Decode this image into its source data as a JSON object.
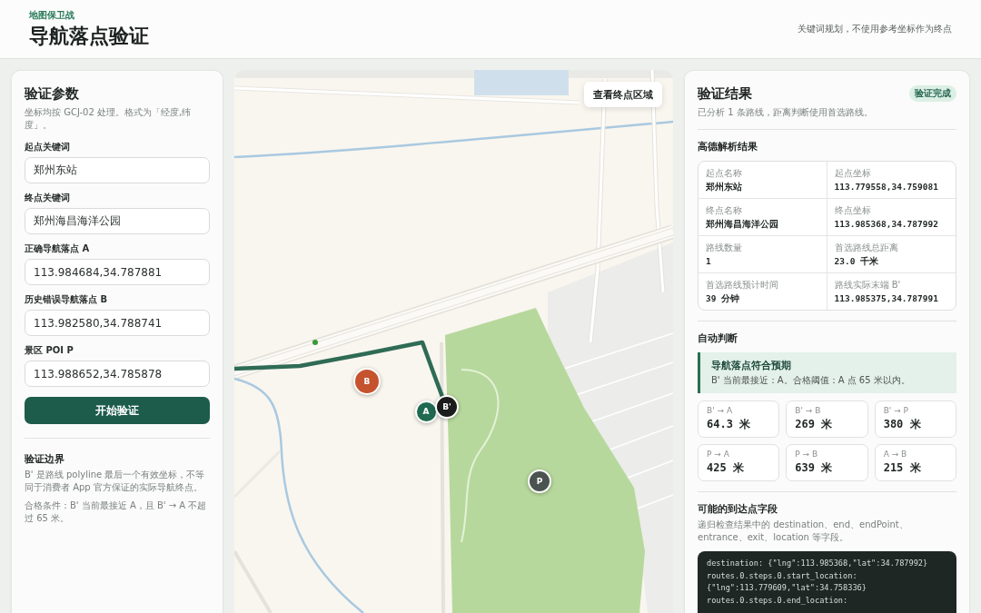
{
  "header": {
    "eyebrow": "地图保卫战",
    "title": "导航落点验证",
    "note": "关键词规划，不使用参考坐标作为终点"
  },
  "params": {
    "title": "验证参数",
    "hint": "坐标均按 GCJ-02 处理。格式为「经度,纬度」。",
    "fields": [
      {
        "label": "起点关键词",
        "value": "郑州东站"
      },
      {
        "label": "终点关键词",
        "value": "郑州海昌海洋公园"
      },
      {
        "label": "正确导航落点 A",
        "value": "113.984684,34.787881"
      },
      {
        "label": "历史错误导航落点 B",
        "value": "113.982580,34.788741"
      },
      {
        "label": "景区 POI P",
        "value": "113.988652,34.785878"
      }
    ],
    "submit": "开始验证",
    "boundary_title": "验证边界",
    "boundary_notes": [
      "B' 是路线 polyline 最后一个有效坐标，不等同于消费者 App 官方保证的实际导航终点。",
      "合格条件：B' 当前最接近 A，且 B' → A 不超过 65 米。"
    ]
  },
  "map": {
    "button": "查看终点区域",
    "markers": [
      {
        "label": "B",
        "color": "#c4532e"
      },
      {
        "label": "A",
        "color": "#1f6a50"
      },
      {
        "label": "B'",
        "color": "#1b1d1c"
      },
      {
        "label": "P",
        "color": "#4b5350"
      }
    ]
  },
  "results": {
    "title": "验证结果",
    "badge": "验证完成",
    "summary": "已分析 1 条路线，距离判断使用首选路线。",
    "parsed_title": "高德解析结果",
    "parsed": [
      {
        "label": "起点名称",
        "value": "郑州东站"
      },
      {
        "label": "起点坐标",
        "value": "113.779558,34.759081"
      },
      {
        "label": "终点名称",
        "value": "郑州海昌海洋公园"
      },
      {
        "label": "终点坐标",
        "value": "113.985368,34.787992"
      },
      {
        "label": "路线数量",
        "value": "1"
      },
      {
        "label": "首选路线总距离",
        "value": "23.0 千米"
      },
      {
        "label": "首选路线预计时间",
        "value": "39 分钟"
      },
      {
        "label": "路线实际末端 B'",
        "value": "113.985375,34.787991"
      }
    ],
    "judgement_title": "自动判断",
    "verdict": {
      "title": "导航落点符合预期",
      "text": "B' 当前最接近：A。合格阈值：A 点 65 米以内。",
      "passed": true
    },
    "distances": [
      {
        "label": "B' → A",
        "value": "64.3 米"
      },
      {
        "label": "B' → B",
        "value": "269 米"
      },
      {
        "label": "B' → P",
        "value": "380 米"
      },
      {
        "label": "P → A",
        "value": "425 米"
      },
      {
        "label": "P → B",
        "value": "639 米"
      },
      {
        "label": "A → B",
        "value": "215 米"
      }
    ],
    "fields_title": "可能的到达点字段",
    "fields_hint": "递归检查结果中的 destination、end、endPoint、entrance、exit、location 等字段。",
    "code_lines": [
      "destination: {\"lng\":113.985368,\"lat\":34.787992}",
      "routes.0.steps.0.start_location:",
      "{\"lng\":113.779609,\"lat\":34.758336}",
      "routes.0.steps.0.end_location:"
    ]
  }
}
